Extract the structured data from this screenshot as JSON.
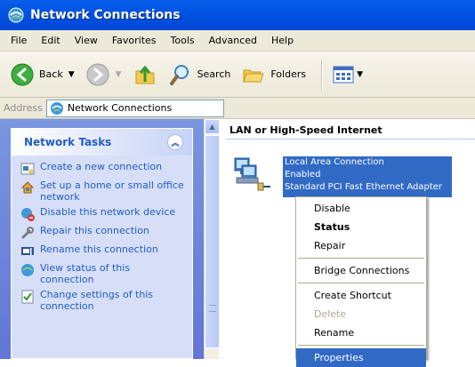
{
  "window": {
    "title": "Network Connections"
  },
  "menubar": {
    "items": [
      "File",
      "Edit",
      "View",
      "Favorites",
      "Tools",
      "Advanced",
      "Help"
    ]
  },
  "toolbar": {
    "back_label": "Back",
    "search_label": "Search",
    "folders_label": "Folders",
    "back_icon": "back-arrow-icon",
    "forward_icon": "forward-arrow-icon",
    "up_icon": "up-folder-icon",
    "search_icon": "search-icon",
    "folders_icon": "folders-icon",
    "views_icon": "views-icon"
  },
  "address": {
    "label": "Address",
    "value": "Network Connections"
  },
  "tasks": {
    "heading": "Network Tasks",
    "items": [
      {
        "label": "Create a new connection",
        "icon": "new-connection-icon"
      },
      {
        "label": "Set up a home or small office network",
        "icon": "home-network-icon"
      },
      {
        "label": "Disable this network device",
        "icon": "disable-device-icon"
      },
      {
        "label": "Repair this connection",
        "icon": "repair-icon"
      },
      {
        "label": "Rename this connection",
        "icon": "rename-icon"
      },
      {
        "label": "View status of this connection",
        "icon": "status-icon"
      },
      {
        "label": "Change settings of this connection",
        "icon": "settings-icon"
      }
    ]
  },
  "main": {
    "group_header": "LAN or High-Speed Internet",
    "connection": {
      "name": "Local Area Connection",
      "status": "Enabled",
      "device": "Standard PCI Fast Ethernet Adapter"
    }
  },
  "context_menu": {
    "items": [
      "Disable",
      "Status",
      "Repair",
      "Bridge Connections",
      "Create Shortcut",
      "Delete",
      "Rename",
      "Properties"
    ]
  },
  "colors": {
    "titlebar": "#0054e3",
    "selection": "#316ac5",
    "task_link": "#215dc6",
    "task_pane": "#6375d6"
  }
}
